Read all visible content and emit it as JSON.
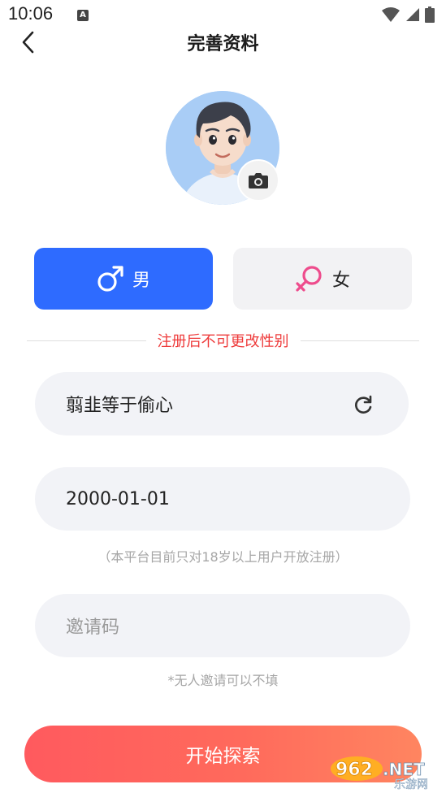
{
  "status_bar": {
    "time": "10:06",
    "notif_letter": "A"
  },
  "header": {
    "title": "完善资料"
  },
  "gender": {
    "male_label": "男",
    "female_label": "女",
    "selected": "male",
    "male_color": "#2e6bff",
    "female_symbol_color": "#ee4c8c"
  },
  "notice": {
    "text": "注册后不可更改性别",
    "color": "#ee3a3a"
  },
  "form": {
    "nickname_value": "翦韭等于偷心",
    "birthday_value": "2000-01-01",
    "age_hint": "（本平台目前只对18岁以上用户开放注册）",
    "invite_placeholder": "邀请码",
    "invite_hint": "*无人邀请可以不填"
  },
  "start_button": {
    "label": "开始探索"
  },
  "watermark": {
    "brand": "962.NET",
    "sub": "乐游网"
  },
  "icons": {
    "back": "chevron-left-icon",
    "camera": "camera-icon",
    "male": "male-symbol-icon",
    "female": "female-symbol-icon",
    "refresh": "refresh-icon"
  }
}
